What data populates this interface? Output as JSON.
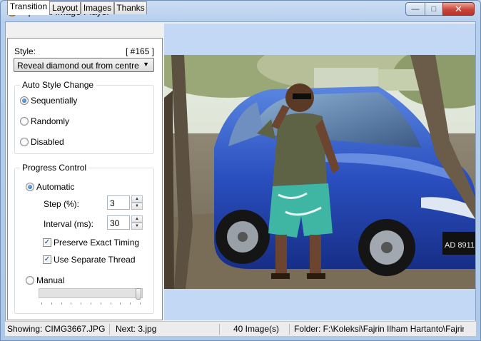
{
  "window": {
    "title": "Special Image Player",
    "close_glyph": "✕",
    "minimize_glyph": "—",
    "maximize_glyph": "□"
  },
  "tabs": [
    {
      "label": "Transition",
      "active": true
    },
    {
      "label": "Layout",
      "active": false
    },
    {
      "label": "Images",
      "active": false
    },
    {
      "label": "Thanks",
      "active": false
    }
  ],
  "transition": {
    "style_label": "Style:",
    "style_index": "[ #165 ]",
    "style_value": "Reveal diamond out from centre",
    "auto_style_change": {
      "title": "Auto Style Change",
      "options": [
        {
          "label": "Sequentially",
          "selected": true
        },
        {
          "label": "Randomly",
          "selected": false
        },
        {
          "label": "Disabled",
          "selected": false
        }
      ]
    },
    "progress_control": {
      "title": "Progress Control",
      "automatic_label": "Automatic",
      "automatic_selected": true,
      "step_label": "Step (%):",
      "step_value": "3",
      "interval_label": "Interval (ms):",
      "interval_value": "30",
      "preserve_timing_label": "Preserve Exact Timing",
      "preserve_timing_checked": true,
      "separate_thread_label": "Use Separate Thread",
      "separate_thread_checked": true,
      "manual_label": "Manual",
      "manual_selected": false,
      "manual_slider_fraction": 1.0
    }
  },
  "status": {
    "showing": "Showing: CIMG3667.JPG",
    "next": "Next: 3.jpg",
    "count": "40 Image(s)",
    "folder": "Folder: F:\\Koleksi\\Fajrin Ilham Hartanto\\Fajrin"
  },
  "photo": {
    "plate_text": "AD 8911"
  },
  "colors": {
    "accent": "#1f5fae",
    "window_frame": "#b7cfee",
    "image_background": "#c2d8f4",
    "close_button": "#c9473a"
  }
}
